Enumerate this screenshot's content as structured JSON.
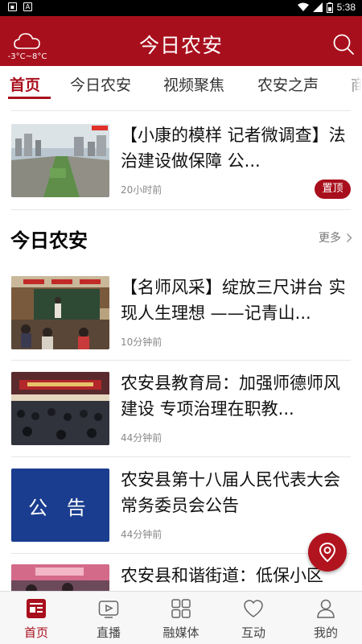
{
  "status_bar": {
    "time": "5:38",
    "left_icons": [
      "notification-icon",
      "app-a-icon"
    ],
    "right_icons": [
      "wifi-icon",
      "signal-icon",
      "battery-icon"
    ]
  },
  "header": {
    "title": "今日农安",
    "weather_temp": "-3°C~8°C"
  },
  "tabs": [
    {
      "label": "首页",
      "active": true
    },
    {
      "label": "今日农安",
      "active": false
    },
    {
      "label": "视频聚焦",
      "active": false
    },
    {
      "label": "农安之声",
      "active": false
    },
    {
      "label": "商",
      "active": false
    }
  ],
  "pinned_news": {
    "title": "【小康的模样 记者微调查】法治建设做保障 公...",
    "time": "20小时前",
    "badge": "置顶"
  },
  "section": {
    "title": "今日农安",
    "more": "更多"
  },
  "news": [
    {
      "title": "【名师风采】绽放三尺讲台 实现人生理想 ——记青山...",
      "time": "10分钟前"
    },
    {
      "title": "农安县教育局：加强师德师风建设 专项治理在职教...",
      "time": "44分钟前"
    },
    {
      "title": "农安县第十八届人民代表大会常务委员会公告",
      "time": "44分钟前",
      "thumb_text": "公 告"
    },
    {
      "title": "农安县和谐街道：低保小区",
      "time": ""
    }
  ],
  "bottom_nav": [
    {
      "label": "首页",
      "icon": "home-news-icon",
      "active": true
    },
    {
      "label": "直播",
      "icon": "live-tv-icon",
      "active": false
    },
    {
      "label": "融媒体",
      "icon": "media-grid-icon",
      "active": false
    },
    {
      "label": "互动",
      "icon": "heart-icon",
      "active": false
    },
    {
      "label": "我的",
      "icon": "user-icon",
      "active": false
    }
  ],
  "colors": {
    "brand": "#a80f1c",
    "nav_bg": "#f7f7f7",
    "notice_blue": "#1a3d8f"
  }
}
